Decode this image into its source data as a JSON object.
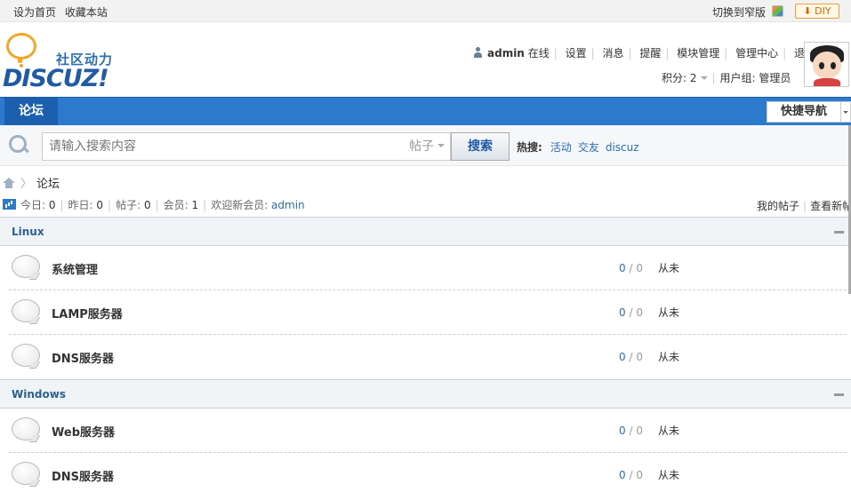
{
  "topbar": {
    "set_home": "设为首页",
    "bookmark": "收藏本站",
    "switch_narrow": "切换到窄版",
    "diy": "DIY"
  },
  "header": {
    "logo_slogan": "社区动力",
    "logo_word": "DISCUZ!",
    "username": "admin",
    "online": "在线",
    "nav_items": [
      "设置",
      "消息",
      "提醒",
      "模块管理",
      "管理中心",
      "退出"
    ],
    "points_label": "积分: 2",
    "usergroup": "用户组: 管理员"
  },
  "navbar": {
    "active_tab": "论坛",
    "quick_nav": "快捷导航"
  },
  "search": {
    "placeholder": "请输入搜索内容",
    "scope": "帖子",
    "button": "搜索",
    "hot_label": "热搜:",
    "hot_terms": [
      "活动",
      "交友",
      "discuz"
    ]
  },
  "breadcrumb": {
    "current": "论坛"
  },
  "stats": {
    "today_label": "今日: ",
    "today": "0",
    "yesterday_label": "昨日: ",
    "yesterday": "0",
    "posts_label": "帖子: ",
    "posts": "0",
    "members_label": "会员: ",
    "members": "1",
    "welcome_label": "欢迎新会员: ",
    "newest_member": "admin",
    "my_posts": "我的帖子",
    "view_new": "查看新帖"
  },
  "groups": [
    {
      "title": "Linux",
      "forums": [
        {
          "name": "系统管理",
          "threads": "0",
          "posts": "0",
          "last": "从未"
        },
        {
          "name": "LAMP服务器",
          "threads": "0",
          "posts": "0",
          "last": "从未"
        },
        {
          "name": "DNS服务器",
          "threads": "0",
          "posts": "0",
          "last": "从未"
        }
      ]
    },
    {
      "title": "Windows",
      "forums": [
        {
          "name": "Web服务器",
          "threads": "0",
          "posts": "0",
          "last": "从未"
        },
        {
          "name": "DNS服务器",
          "threads": "0",
          "posts": "0",
          "last": "从未"
        }
      ]
    }
  ],
  "colors": {
    "brand_blue": "#2b7acd",
    "link_blue": "#2b6fb8",
    "logo_orange": "#f5a623"
  }
}
